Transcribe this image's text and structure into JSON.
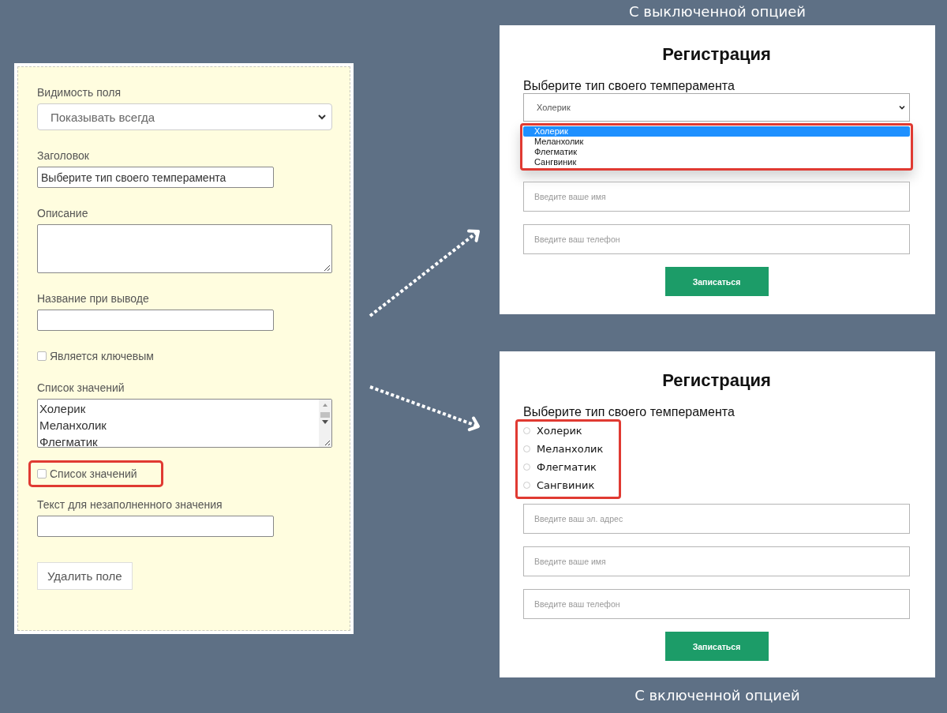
{
  "settings_panel": {
    "fields": [
      {
        "kind": "select",
        "label": "Видимость поля",
        "value": "Показывать всегда"
      },
      {
        "kind": "text",
        "label": "Заголовок",
        "value": "Выберите тип своего темперамента"
      },
      {
        "kind": "textarea",
        "label": "Описание"
      },
      {
        "kind": "text",
        "label": "Название при выводе"
      },
      {
        "kind": "checkbox",
        "label": "Является ключевым",
        "checked": false,
        "highlighted": false
      },
      {
        "kind": "listbox",
        "label": "Список значений",
        "options": [
          "Холерик",
          "Меланхолик",
          "Флегматик"
        ]
      },
      {
        "kind": "checkbox",
        "label": "Список значений",
        "checked": false,
        "highlighted": true
      },
      {
        "kind": "text",
        "label": "Текст для незаполненного значения"
      }
    ],
    "delete_button": "Удалить поле"
  },
  "previews": [
    {
      "caption": {
        "text": "С выключенной опцией",
        "kind": "above"
      },
      "title": "Регистрация",
      "question": "Выберите тип своего темперамента",
      "kind": "dropdown",
      "select_value": "Холерик",
      "options": [
        {
          "label": "Холерик",
          "selected": true
        },
        {
          "label": "Меланхолик",
          "selected": false
        },
        {
          "label": "Флегматик",
          "selected": false
        },
        {
          "label": "Сангвиник",
          "selected": false
        }
      ],
      "fields": [
        {
          "placeholder": "Введите ваше имя"
        },
        {
          "placeholder": "Введите ваш телефон"
        }
      ],
      "submit": "Записаться"
    },
    {
      "caption": {
        "text": "С включенной опцией",
        "kind": "below"
      },
      "title": "Регистрация",
      "question": "Выберите тип своего темперамента",
      "kind": "radio",
      "options": [
        {
          "label": "Холерик",
          "selected": false
        },
        {
          "label": "Меланхолик",
          "selected": false
        },
        {
          "label": "Флегматик",
          "selected": false
        },
        {
          "label": "Сангвиник",
          "selected": false
        }
      ],
      "fields": [
        {
          "placeholder": "Введите ваш эл. адрес"
        },
        {
          "placeholder": "Введите ваше имя"
        },
        {
          "placeholder": "Введите ваш телефон"
        }
      ],
      "submit": "Записаться"
    }
  ]
}
